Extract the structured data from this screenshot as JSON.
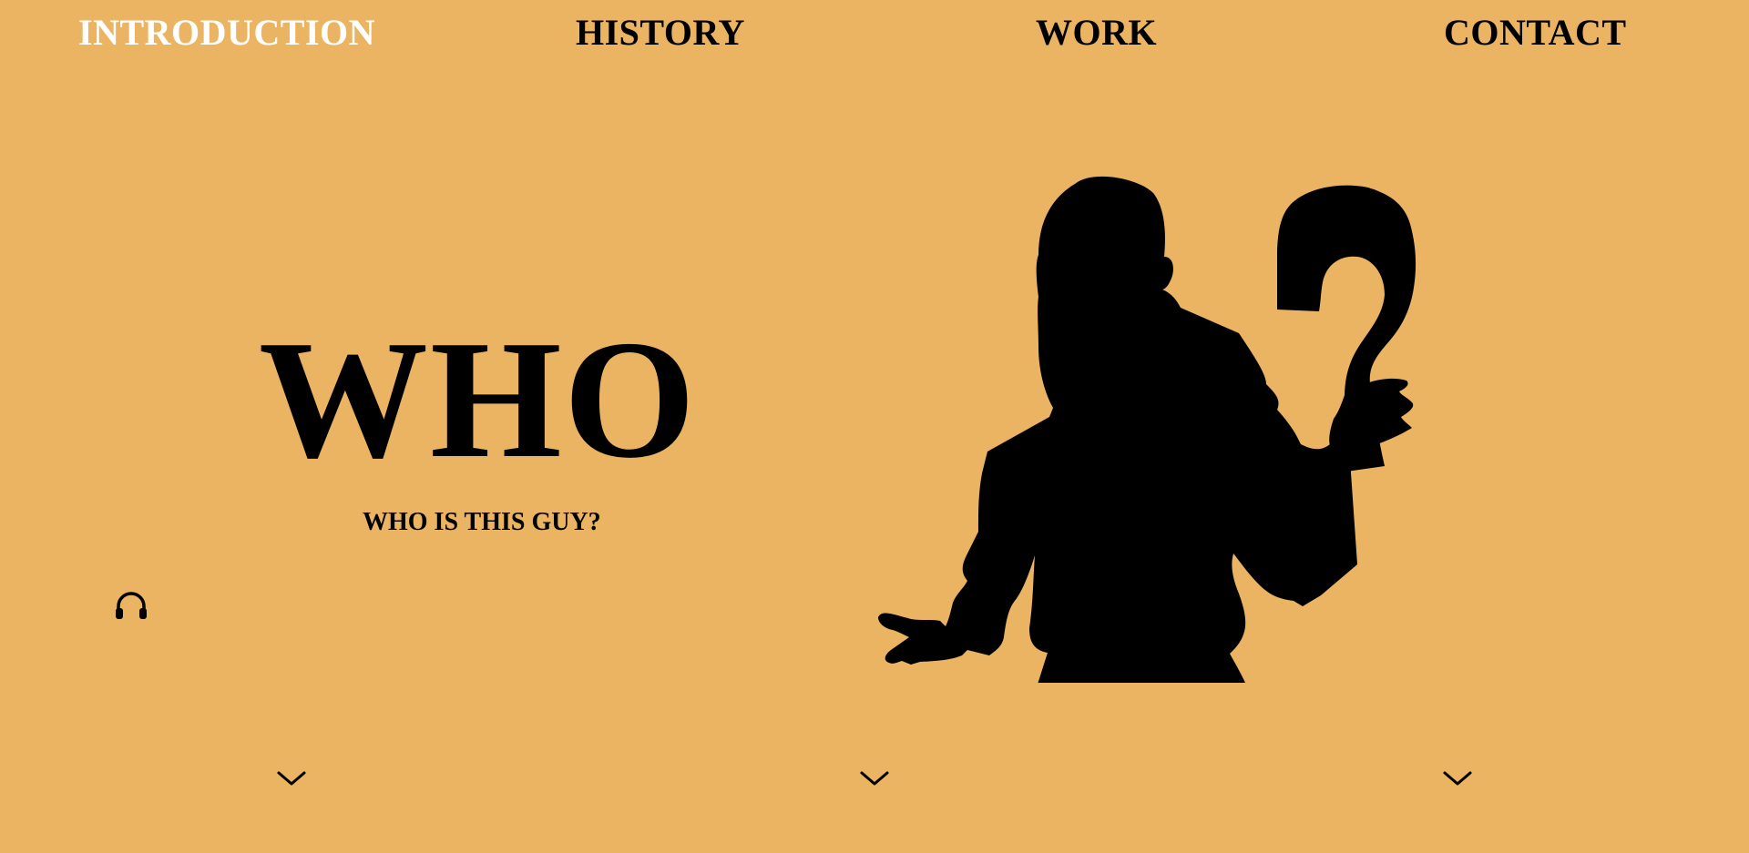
{
  "nav": {
    "items": [
      {
        "label": "INTRODUCTION",
        "active": true
      },
      {
        "label": "HISTORY",
        "active": false
      },
      {
        "label": "WORK",
        "active": false
      },
      {
        "label": "CONTACT",
        "active": false
      }
    ]
  },
  "hero": {
    "title": "WHO",
    "subtitle": "WHO IS THIS GUY?"
  },
  "icons": {
    "audio": "headphones-icon",
    "scroll": "chevron-down-icon"
  },
  "colors": {
    "background": "#eab463",
    "active_nav": "#ffffff",
    "text": "#000000"
  }
}
